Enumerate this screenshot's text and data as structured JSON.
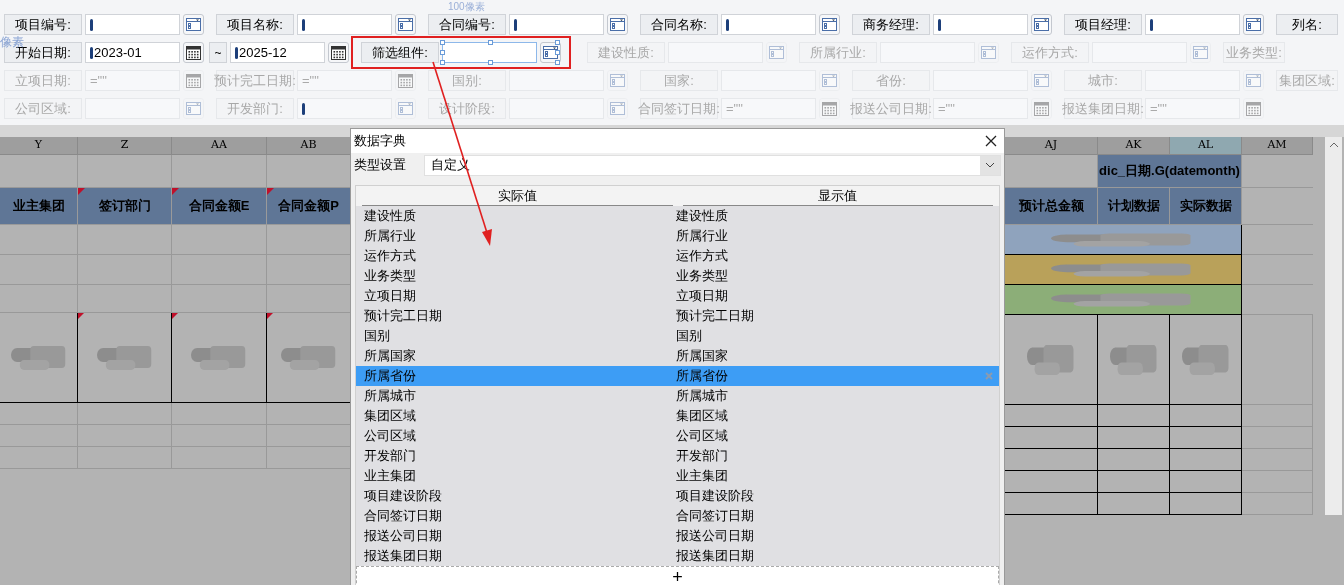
{
  "rulers": {
    "top": "100像素",
    "left": "像素"
  },
  "filters": [
    [
      {
        "kind": "select",
        "label": "项目编号:",
        "cursor": true,
        "disabled": false,
        "selected": false
      },
      {
        "kind": "select",
        "label": "项目名称:",
        "cursor": true,
        "disabled": false,
        "selected": false
      },
      {
        "kind": "select",
        "label": "合同编号:",
        "cursor": true,
        "disabled": false,
        "selected": false
      },
      {
        "kind": "select",
        "label": "合同名称:",
        "cursor": true,
        "disabled": false,
        "selected": false
      },
      {
        "kind": "select",
        "label": "商务经理:",
        "cursor": true,
        "disabled": false,
        "selected": false
      },
      {
        "kind": "select",
        "label": "项目经理:",
        "cursor": true,
        "disabled": false,
        "selected": false
      },
      {
        "kind": "label",
        "label": "列名:",
        "disabled": false
      }
    ],
    [
      {
        "kind": "range",
        "label": "开始日期:",
        "value": "2023-01",
        "separator": "~",
        "value2": "2025-12",
        "cursor": true,
        "disabled": false,
        "selected": false
      },
      {
        "kind": "select",
        "label": "筛选组件:",
        "cursor": false,
        "disabled": false,
        "selected": true
      },
      {
        "kind": "select",
        "label": "建设性质:",
        "cursor": false,
        "disabled": true,
        "selected": false
      },
      {
        "kind": "select",
        "label": "所属行业:",
        "cursor": false,
        "disabled": true,
        "selected": false
      },
      {
        "kind": "select",
        "label": "运作方式:",
        "cursor": false,
        "disabled": true,
        "selected": false
      },
      {
        "kind": "label",
        "label": "业务类型:",
        "disabled": true
      }
    ],
    [
      {
        "kind": "date",
        "label": "立项日期:",
        "value": "=\"\"",
        "cursor": false,
        "disabled": true,
        "selected": false
      },
      {
        "kind": "date",
        "label": "预计完工日期:",
        "value": "=\"\"",
        "cursor": false,
        "disabled": true,
        "selected": false
      },
      {
        "kind": "select",
        "label": "国别:",
        "cursor": false,
        "disabled": true,
        "selected": false
      },
      {
        "kind": "select",
        "label": "国家:",
        "cursor": false,
        "disabled": true,
        "selected": false
      },
      {
        "kind": "select",
        "label": "省份:",
        "cursor": false,
        "disabled": true,
        "selected": false
      },
      {
        "kind": "select",
        "label": "城市:",
        "cursor": false,
        "disabled": true,
        "selected": false
      },
      {
        "kind": "label",
        "label": "集团区域:",
        "disabled": true
      }
    ],
    [
      {
        "kind": "select",
        "label": "公司区域:",
        "cursor": false,
        "disabled": true,
        "selected": false
      },
      {
        "kind": "select",
        "label": "开发部门:",
        "cursor": true,
        "disabled": true,
        "selected": false
      },
      {
        "kind": "select",
        "label": "设计阶段:",
        "cursor": false,
        "disabled": true,
        "selected": false
      },
      {
        "kind": "date",
        "label": "合同签订日期:",
        "value": "=\"\"",
        "cursor": false,
        "disabled": true,
        "selected": false
      },
      {
        "kind": "date",
        "label": "报送公司日期:",
        "value": "=\"\"",
        "cursor": false,
        "disabled": true,
        "selected": false
      },
      {
        "kind": "date",
        "label": "报送集团日期:",
        "value": "=\"\"",
        "cursor": false,
        "disabled": true,
        "selected": false
      }
    ]
  ],
  "sheet": {
    "left_columns": [
      {
        "letter": "Y",
        "selected": false
      },
      {
        "letter": "Z",
        "selected": false
      },
      {
        "letter": "AA",
        "selected": false
      },
      {
        "letter": "AB",
        "selected": false
      }
    ],
    "left_headers": [
      {
        "text": "业主集团",
        "flagged": false
      },
      {
        "text": "签订部门",
        "flagged": true
      },
      {
        "text": "合同金额E",
        "flagged": true
      },
      {
        "text": "合同金额P",
        "flagged": true
      }
    ],
    "right_columns": [
      {
        "letter": "AJ",
        "selected": false
      },
      {
        "letter": "AK",
        "selected": false
      },
      {
        "letter": "AL",
        "selected": true
      },
      {
        "letter": "AM",
        "selected": false
      }
    ],
    "merged_header": "dic_日期.G(datemonth)",
    "right_headers": [
      "预计总金额",
      "计划数据",
      "实际数据"
    ],
    "bands": [
      {
        "color": "#8fa3bd"
      },
      {
        "color": "#b9a15a"
      },
      {
        "color": "#8cae78"
      }
    ]
  },
  "dialog": {
    "title": "数据字典",
    "type_label": "类型设置",
    "type_value": "自定义",
    "columns": [
      "实际值",
      "显示值"
    ],
    "rows": [
      {
        "actual": "建设性质",
        "display": "建设性质",
        "selected": false
      },
      {
        "actual": "所属行业",
        "display": "所属行业",
        "selected": false
      },
      {
        "actual": "运作方式",
        "display": "运作方式",
        "selected": false
      },
      {
        "actual": "业务类型",
        "display": "业务类型",
        "selected": false
      },
      {
        "actual": "立项日期",
        "display": "立项日期",
        "selected": false
      },
      {
        "actual": "预计完工日期",
        "display": "预计完工日期",
        "selected": false
      },
      {
        "actual": "国别",
        "display": "国别",
        "selected": false
      },
      {
        "actual": "所属国家",
        "display": "所属国家",
        "selected": false
      },
      {
        "actual": "所属省份",
        "display": "所属省份",
        "selected": true
      },
      {
        "actual": "所属城市",
        "display": "所属城市",
        "selected": false
      },
      {
        "actual": "集团区域",
        "display": "集团区域",
        "selected": false
      },
      {
        "actual": "公司区域",
        "display": "公司区域",
        "selected": false
      },
      {
        "actual": "开发部门",
        "display": "开发部门",
        "selected": false
      },
      {
        "actual": "业主集团",
        "display": "业主集团",
        "selected": false
      },
      {
        "actual": "项目建设阶段",
        "display": "项目建设阶段",
        "selected": false
      },
      {
        "actual": "合同签订日期",
        "display": "合同签订日期",
        "selected": false
      },
      {
        "actual": "报送公司日期",
        "display": "报送公司日期",
        "selected": false
      },
      {
        "actual": "报送集团日期",
        "display": "报送集团日期",
        "selected": false
      }
    ],
    "add_button": "+"
  }
}
